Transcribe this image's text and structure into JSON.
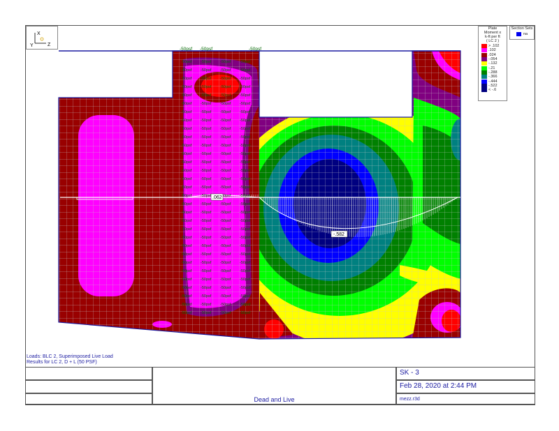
{
  "notes": {
    "line1": "Loads: BLC 2, Superimposed Live Load",
    "line2": "Results for LC 2, D + L (50 PSF)"
  },
  "triad": {
    "x": "X",
    "y": "Y",
    "z": "Z"
  },
  "legend": {
    "title1": "Plate",
    "title2": "Moment x",
    "title3": "k-ft per ft",
    "title4": "( LC 2 )",
    "items": [
      {
        "label": "> .102",
        "color": "#ff0000"
      },
      {
        "label": ".102",
        "color": "#ff00ff"
      },
      {
        "label": ".024",
        "color": "#990000"
      },
      {
        "label": "-.054",
        "color": "#800080"
      },
      {
        "label": "-.132",
        "color": "#ffff00"
      },
      {
        "label": "-.21",
        "color": "#00ff00"
      },
      {
        "label": "-.288",
        "color": "#008000"
      },
      {
        "label": "-.366",
        "color": "#008080"
      },
      {
        "label": "-.444",
        "color": "#0000ff"
      },
      {
        "label": "-.522",
        "color": "#000080"
      },
      {
        "label": "< -.6",
        "color": "#000080"
      }
    ]
  },
  "section_sets": {
    "title": "Section Sets",
    "item": "na",
    "color": "#0000ee"
  },
  "annotations": {
    "max_label": ".062",
    "min_label": "-.582",
    "load_label": "-50psf"
  },
  "title_block": {
    "sheet": "SK - 3",
    "date": "Feb 28, 2020 at 2:44 PM",
    "file": "mezz.r3d",
    "description": "Dead and Live"
  }
}
